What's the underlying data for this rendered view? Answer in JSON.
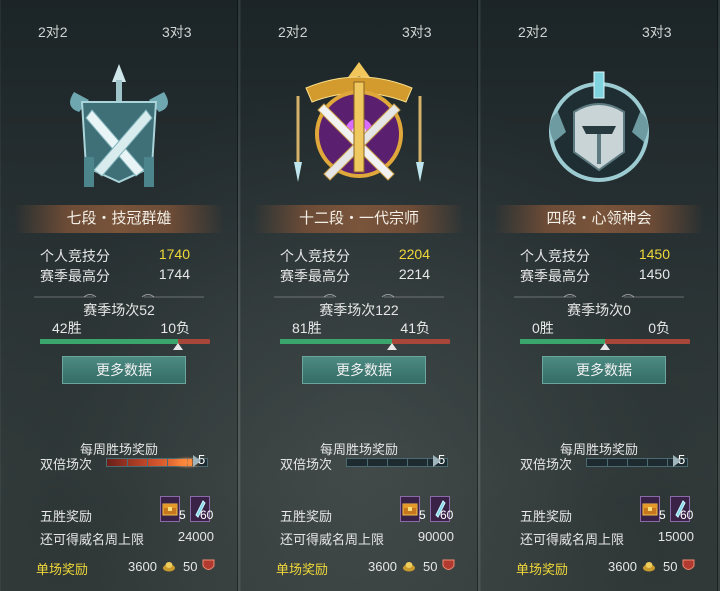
{
  "panels": [
    {
      "modes": [
        "2对2",
        "3对3"
      ],
      "emblem": "silver-crossed-swords-emblem",
      "rank": "七段・技冠群雄",
      "personal_label": "个人竞技分",
      "personal_value": "1740",
      "best_label": "赛季最高分",
      "best_value": "1744",
      "season_label": "赛季场次52",
      "wins": "42胜",
      "losses": "10负",
      "win_ratio": 0.81,
      "more_button": "更多数据",
      "weekly_title": "每周胜场奖励",
      "double_label": "双倍场次",
      "double_count": "5",
      "double_progress": 0.85,
      "five_label": "五胜奖励",
      "item1_count": "5",
      "item2_count": "60",
      "cap_label": "还可得威名周上限",
      "cap_value": "24000",
      "single_label": "单场奖励",
      "single_gold": "3600",
      "single_honor": "50"
    },
    {
      "modes": [
        "2对2",
        "3对3"
      ],
      "emblem": "golden-purple-crest-emblem",
      "rank": "十二段・一代宗师",
      "personal_label": "个人竞技分",
      "personal_value": "2204",
      "best_label": "赛季最高分",
      "best_value": "2214",
      "season_label": "赛季场次122",
      "wins": "81胜",
      "losses": "41负",
      "win_ratio": 0.66,
      "more_button": "更多数据",
      "weekly_title": "每周胜场奖励",
      "double_label": "双倍场次",
      "double_count": "5",
      "double_progress": 0.0,
      "five_label": "五胜奖励",
      "item1_count": "5",
      "item2_count": "60",
      "cap_label": "还可得威名周上限",
      "cap_value": "90000",
      "single_label": "单场奖励",
      "single_gold": "3600",
      "single_honor": "50"
    },
    {
      "modes": [
        "2对2",
        "3对3"
      ],
      "emblem": "dark-helmet-crest-emblem",
      "rank": "四段・心领神会",
      "personal_label": "个人竞技分",
      "personal_value": "1450",
      "best_label": "赛季最高分",
      "best_value": "1450",
      "season_label": "赛季场次0",
      "wins": "0胜",
      "losses": "0负",
      "win_ratio": 0.5,
      "more_button": "更多数据",
      "weekly_title": "每周胜场奖励",
      "double_label": "双倍场次",
      "double_count": "5",
      "double_progress": 0.0,
      "five_label": "五胜奖励",
      "item1_count": "5",
      "item2_count": "60",
      "cap_label": "还可得威名周上限",
      "cap_value": "15000",
      "single_label": "单场奖励",
      "single_gold": "3600",
      "single_honor": "50"
    }
  ]
}
